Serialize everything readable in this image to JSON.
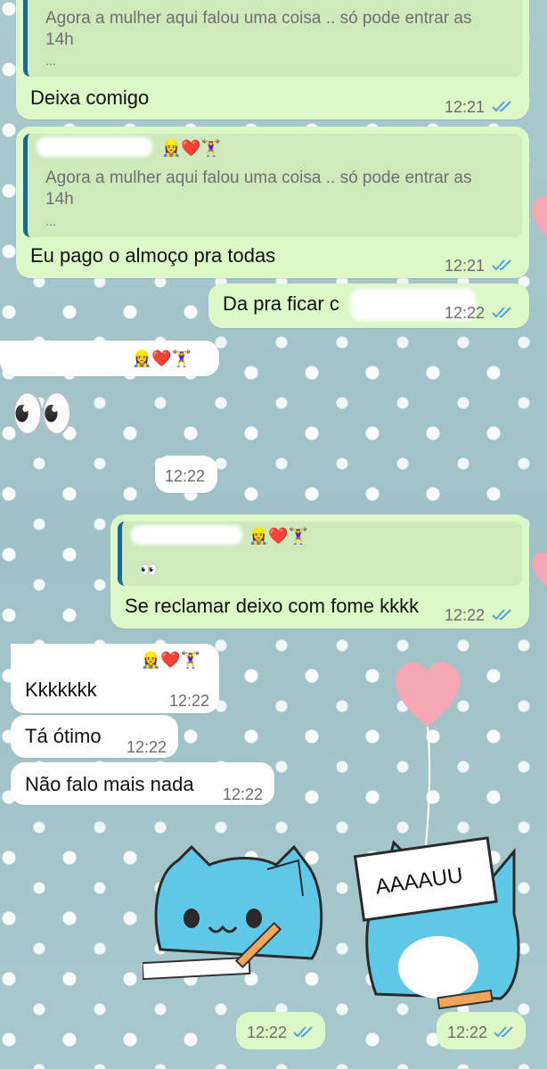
{
  "messages": {
    "m1": {
      "quote_line1": "Agora a mulher aqui falou uma coisa .. só pode entrar as",
      "quote_line2": "14h",
      "quote_more": "...",
      "text": "Deixa comigo",
      "time": "12:21"
    },
    "m2": {
      "quote_emojis": "👷‍♀️❤️🏋️‍♀️",
      "quote_line1": "Agora a mulher aqui falou uma coisa .. só pode entrar as",
      "quote_line2": "14h",
      "quote_more": "...",
      "text": "Eu pago o almoço pra todas",
      "time": "12:21"
    },
    "m3": {
      "text": "Da pra ficar c",
      "time": "12:22"
    },
    "m4": {
      "emojis": "👷‍♀️❤️🏋️‍♀️"
    },
    "m5": {
      "emoji": "👀"
    },
    "m6": {
      "time": "12:22"
    },
    "m7": {
      "quote_emojis": "👷‍♀️❤️🏋️‍♀️",
      "quote_text": "👀",
      "text": "Se reclamar deixo com fome kkkk",
      "time": "12:22"
    },
    "m8": {
      "header_emojis": "👷‍♀️❤️🏋️‍♀️",
      "text": "Kkkkkkk",
      "time": "12:22"
    },
    "m9": {
      "text": "Tá ótimo",
      "time": "12:22"
    },
    "m10": {
      "text": "Não falo mais nada",
      "time": "12:22"
    }
  },
  "stickers": {
    "s1": {
      "time": "12:22"
    },
    "s2": {
      "sign_text": "AAAAUU",
      "time": "12:22"
    }
  },
  "colors": {
    "outgoing": "#dcf8c6",
    "incoming": "#ffffff",
    "ticks": "#4fa3e0"
  }
}
